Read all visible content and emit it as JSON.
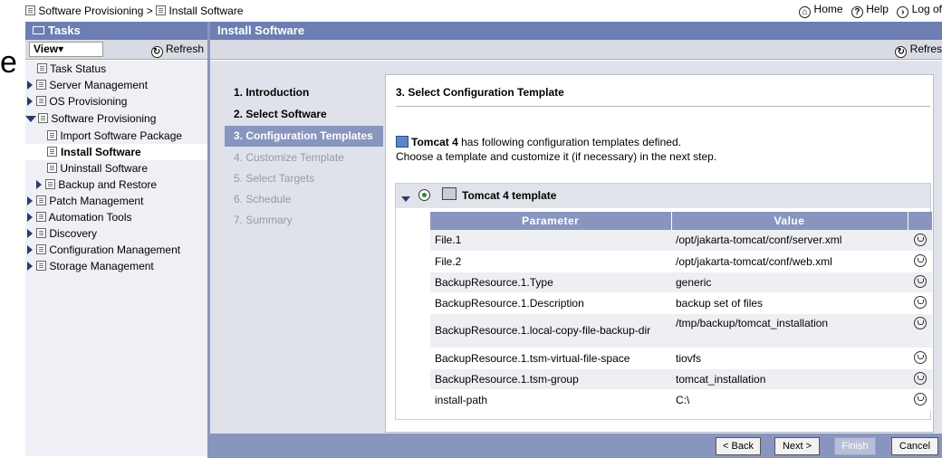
{
  "breadcrumb": {
    "parent": "Software Provisioning",
    "separator": ">",
    "current": "Install Software"
  },
  "top_links": {
    "home": "Home",
    "help": "Help",
    "logout": "Log of"
  },
  "tasks": {
    "title": "Tasks",
    "view_label": "View",
    "refresh_label": "Refresh",
    "tree": [
      {
        "label": "Task Status"
      },
      {
        "label": "Server Management"
      },
      {
        "label": "OS Provisioning"
      },
      {
        "label": "Software Provisioning"
      },
      {
        "label": "Import Software Package"
      },
      {
        "label": "Install Software"
      },
      {
        "label": "Uninstall Software"
      },
      {
        "label": "Backup and Restore"
      },
      {
        "label": "Patch Management"
      },
      {
        "label": "Automation Tools"
      },
      {
        "label": "Discovery"
      },
      {
        "label": "Configuration Management"
      },
      {
        "label": "Storage Management"
      }
    ]
  },
  "main": {
    "title": "Install Software",
    "refresh_label": "Refres",
    "stray_text": "e"
  },
  "wizard": {
    "steps": [
      {
        "label": "1. Introduction"
      },
      {
        "label": "2. Select Software"
      },
      {
        "label": "3. Configuration Templates"
      },
      {
        "label": "4. Customize Template"
      },
      {
        "label": "5. Select Targets"
      },
      {
        "label": "6. Schedule"
      },
      {
        "label": "7. Summary"
      }
    ],
    "current_step": 3
  },
  "content": {
    "title": "3. Select Configuration Template",
    "software_name": "Tomcat 4",
    "desc_line1_rest": " has following configuration templates defined.",
    "desc_line2": "Choose a template and customize it (if necessary) in the next step.",
    "template_name": "Tomcat 4 template"
  },
  "params_table": {
    "headers": {
      "parameter": "Parameter",
      "value": "Value"
    },
    "rows": [
      {
        "parameter": "File.1",
        "value": "/opt/jakarta-tomcat/conf/server.xml"
      },
      {
        "parameter": "File.2",
        "value": "/opt/jakarta-tomcat/conf/web.xml"
      },
      {
        "parameter": "BackupResource.1.Type",
        "value": "generic"
      },
      {
        "parameter": "BackupResource.1.Description",
        "value": "backup set of files"
      },
      {
        "parameter": "BackupResource.1.local-copy-file-backup-dir",
        "value": "/tmp/backup/tomcat_installation"
      },
      {
        "parameter": "BackupResource.1.tsm-virtual-file-space",
        "value": "tiovfs"
      },
      {
        "parameter": "BackupResource.1.tsm-group",
        "value": "tomcat_installation"
      },
      {
        "parameter": "install-path",
        "value": "C:\\"
      }
    ]
  },
  "buttons": {
    "back": "< Back",
    "next": "Next >",
    "finish": "Finish",
    "cancel": "Cancel"
  }
}
